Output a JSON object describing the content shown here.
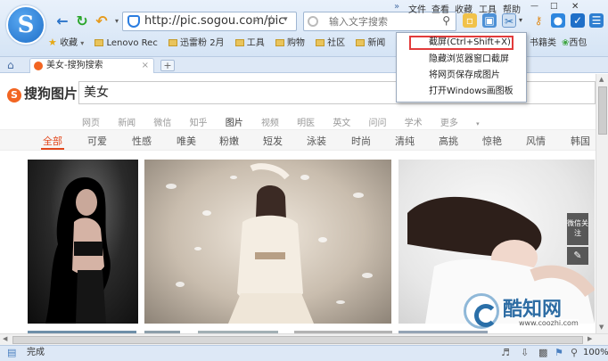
{
  "browser": {
    "logo_glyph": "S",
    "address_url": "http://pic.sogou.com/pic",
    "search_placeholder": "输入文字搜索",
    "menu": [
      "文件",
      "查看",
      "收藏",
      "工具",
      "帮助"
    ],
    "bookmarks": [
      {
        "label": "收藏",
        "type": "star"
      },
      {
        "label": "Lenovo Rec",
        "type": "folder"
      },
      {
        "label": "迅雷粉 2月",
        "type": "folder"
      },
      {
        "label": "工具",
        "type": "folder"
      },
      {
        "label": "购物",
        "type": "folder"
      },
      {
        "label": "社区",
        "type": "folder"
      },
      {
        "label": "新闻",
        "type": "folder"
      },
      {
        "label": "影音",
        "type": "folder"
      }
    ],
    "bookmarks_right": [
      "书籍类",
      "西包"
    ],
    "tab_title": "美女-搜狗搜索",
    "tab_new": "+",
    "status_text": "完成",
    "zoom": "100%"
  },
  "dropdown": {
    "items": [
      "截屏(Ctrl+Shift+X)",
      "隐藏浏览器窗口截屏",
      "将网页保存成图片",
      "打开Windows画图板"
    ],
    "selected_index": 0
  },
  "page": {
    "logo_text": "搜狗图片",
    "query": "美女",
    "search_types": [
      "网页",
      "新闻",
      "微信",
      "知乎",
      "图片",
      "视频",
      "明医",
      "英文",
      "问问",
      "学术",
      "更多"
    ],
    "active_type": "图片",
    "categories": [
      "全部",
      "可爱",
      "性感",
      "唯美",
      "粉嫩",
      "短发",
      "泳装",
      "时尚",
      "清纯",
      "高挑",
      "惊艳",
      "风情",
      "韩国"
    ],
    "active_category": "全部",
    "float_buttons": [
      "微信关注"
    ]
  },
  "watermark": {
    "title": "酷知网",
    "url": "www.coozhi.com"
  },
  "colors": {
    "accent": "#e2471c",
    "chrome": "#dde8f6",
    "highlight_border": "#e23b3b"
  }
}
